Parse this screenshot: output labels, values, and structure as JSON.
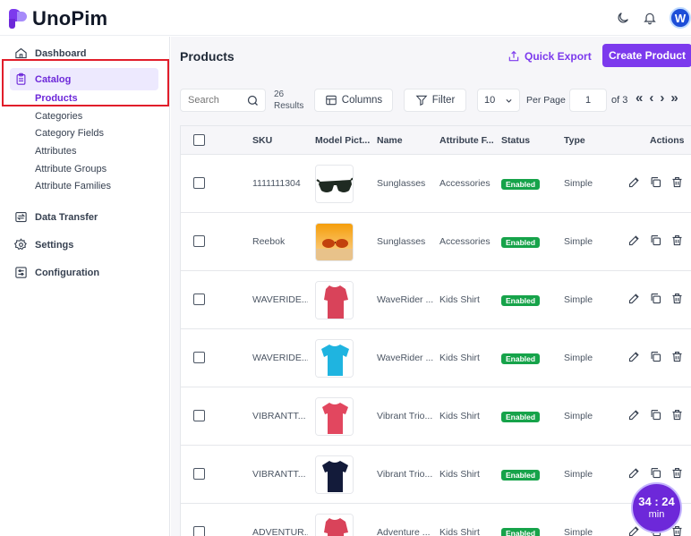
{
  "app": {
    "name": "UnoPim",
    "avatar_letter": "W"
  },
  "sidebar": {
    "items": [
      {
        "label": "Dashboard",
        "icon": "home-icon"
      },
      {
        "label": "Catalog",
        "icon": "clipboard-icon"
      },
      {
        "label": "Data Transfer",
        "icon": "transfer-icon"
      },
      {
        "label": "Settings",
        "icon": "gear-icon"
      },
      {
        "label": "Configuration",
        "icon": "sliders-icon"
      }
    ],
    "catalog_sub": [
      "Products",
      "Categories",
      "Category Fields",
      "Attributes",
      "Attribute Groups",
      "Attribute Families"
    ],
    "active_sub": "Products"
  },
  "main": {
    "title": "Products",
    "quick_export_label": "Quick Export",
    "create_label": "Create Product"
  },
  "toolbar": {
    "search_placeholder": "Search",
    "results_count": "26",
    "results_label": "Results",
    "columns_label": "Columns",
    "filter_label": "Filter",
    "per_page_value": "10",
    "per_page_label": "Per Page",
    "page_value": "1",
    "page_of": "of 3"
  },
  "table": {
    "headers": [
      "SKU",
      "Model Pict...",
      "Name",
      "Attribute F...",
      "Status",
      "Type",
      "Actions"
    ],
    "rows": [
      {
        "sku": "1111111304",
        "image": "sunglasses-black",
        "name": "Sunglasses",
        "family": "Accessories",
        "status": "Enabled",
        "type": "Simple"
      },
      {
        "sku": "Reebok",
        "image": "sunglasses-orange",
        "name": "Sunglasses",
        "family": "Accessories",
        "status": "Enabled",
        "type": "Simple"
      },
      {
        "sku": "WAVERIDE...",
        "image": "shirt-red",
        "name": "WaveRider ...",
        "family": "Kids Shirt",
        "status": "Enabled",
        "type": "Simple"
      },
      {
        "sku": "WAVERIDE...",
        "image": "shirt-cyan",
        "name": "WaveRider ...",
        "family": "Kids Shirt",
        "status": "Enabled",
        "type": "Simple"
      },
      {
        "sku": "VIBRANTT...",
        "image": "shirt-coral",
        "name": "Vibrant Trio...",
        "family": "Kids Shirt",
        "status": "Enabled",
        "type": "Simple"
      },
      {
        "sku": "VIBRANTT...",
        "image": "shirt-navy",
        "name": "Vibrant Trio...",
        "family": "Kids Shirt",
        "status": "Enabled",
        "type": "Simple"
      },
      {
        "sku": "ADVENTUR...",
        "image": "shirt-red",
        "name": "Adventure ...",
        "family": "Kids Shirt",
        "status": "Enabled",
        "type": "Simple"
      }
    ]
  },
  "timer": {
    "time": "34 : 24",
    "unit": "min"
  },
  "colors": {
    "accent": "#7c3aed",
    "enabled": "#16a34a",
    "highlight": "#e11d2a"
  }
}
